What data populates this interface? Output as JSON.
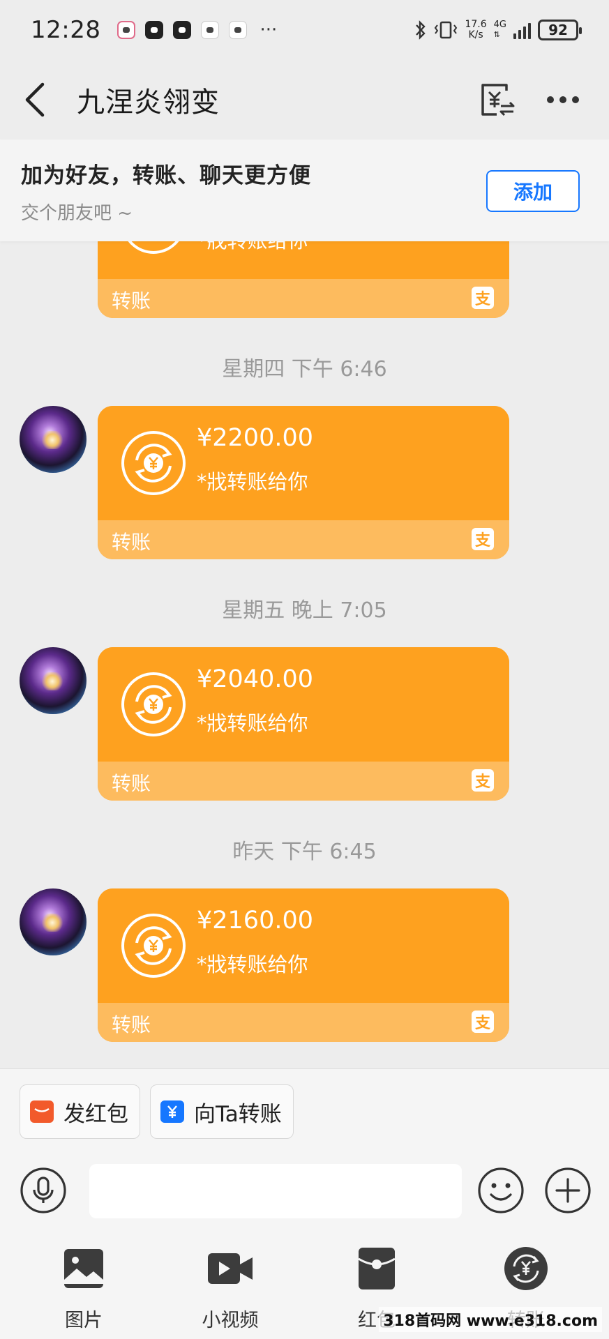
{
  "status_bar": {
    "time": "12:28",
    "more": "···",
    "net_speed_value": "17.6",
    "net_speed_unit": "K/s",
    "network_type": "4G",
    "battery": "92"
  },
  "header": {
    "title": "九涅炎翎变"
  },
  "friend_banner": {
    "title": "加为好友，转账、聊天更方便",
    "subtitle": "交个朋友吧 ~",
    "add_label": "添加"
  },
  "chat": {
    "partial_message": {
      "note": "*戕转账给你",
      "footer_label": "转账"
    },
    "messages": [
      {
        "time": "星期四 下午 6:46",
        "amount": "¥2200.00",
        "note": "*戕转账给你",
        "footer_label": "转账"
      },
      {
        "time": "星期五 晚上 7:05",
        "amount": "¥2040.00",
        "note": "*戕转账给你",
        "footer_label": "转账"
      },
      {
        "time": "昨天 下午 6:45",
        "amount": "¥2160.00",
        "note": "*戕转账给你",
        "footer_label": "转账"
      }
    ],
    "bubble_color": "#fea11f",
    "bubble_footer_color": "#fdbb5e",
    "alipay_mark": "支"
  },
  "quick_actions": {
    "red_packet_label": "发红包",
    "transfer_label": "向Ta转账"
  },
  "input": {
    "placeholder": ""
  },
  "tools": {
    "photo_label": "图片",
    "video_label": "小视频",
    "red_packet_label": "红包",
    "transfer_label": "转账"
  },
  "watermark": "318首码网 www.e318.com",
  "accent_color": "#1677ff"
}
